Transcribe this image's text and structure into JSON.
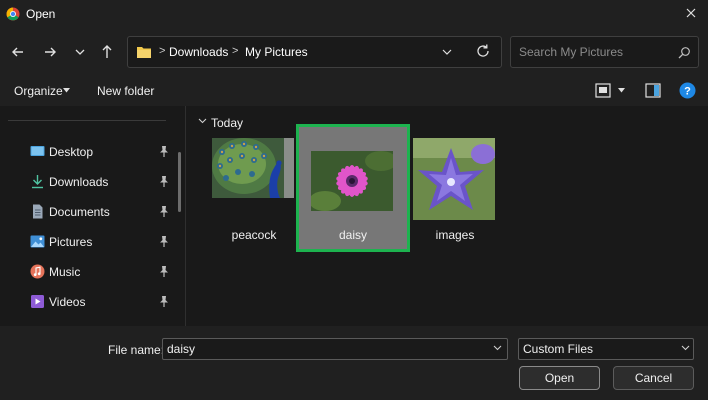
{
  "window": {
    "title": "Open"
  },
  "address": {
    "crumbs": [
      "Downloads",
      "My Pictures"
    ],
    "separator": ">"
  },
  "search": {
    "placeholder": "Search My Pictures"
  },
  "commands": {
    "organize": "Organize",
    "new_folder": "New folder"
  },
  "nav_pane": {
    "items": [
      {
        "label": "Desktop",
        "icon": "desktop-icon",
        "pinned": true
      },
      {
        "label": "Downloads",
        "icon": "download-icon",
        "pinned": true
      },
      {
        "label": "Documents",
        "icon": "document-icon",
        "pinned": true
      },
      {
        "label": "Pictures",
        "icon": "pictures-icon",
        "pinned": true
      },
      {
        "label": "Music",
        "icon": "music-icon",
        "pinned": true
      },
      {
        "label": "Videos",
        "icon": "videos-icon",
        "pinned": true
      }
    ]
  },
  "files": {
    "group": "Today",
    "items": [
      {
        "name": "peacock",
        "selected": false
      },
      {
        "name": "daisy",
        "selected": true
      },
      {
        "name": "images",
        "selected": false
      }
    ]
  },
  "footer": {
    "file_name_label": "File name:",
    "file_name_value": "daisy",
    "file_type_value": "Custom Files",
    "open_label": "Open",
    "cancel_label": "Cancel"
  },
  "colors": {
    "selection_border": "#1db34f",
    "selection_fill": "#777777",
    "help_blue": "#1e88e5",
    "folder_yellow": "#f2c94c"
  }
}
